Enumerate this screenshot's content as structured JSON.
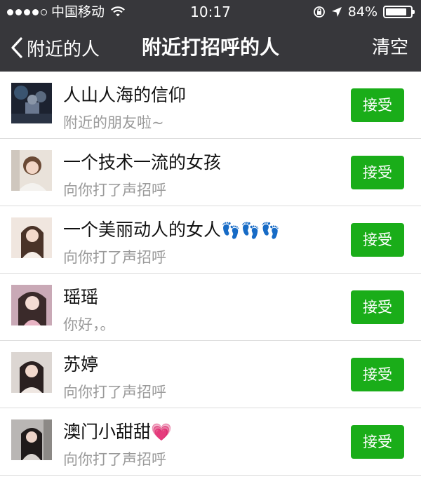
{
  "status_bar": {
    "carrier": "中国移动",
    "time": "10:17",
    "battery_text": "84%",
    "battery_level": 0.84
  },
  "nav": {
    "back_label": "附近的人",
    "title": "附近打招呼的人",
    "action_label": "清空"
  },
  "colors": {
    "header_bg": "#37373b",
    "accept_green": "#1aad19"
  },
  "rows": [
    {
      "name": "人山人海的信仰",
      "message": "附近的朋友啦~",
      "accept_label": "接受",
      "emoji": ""
    },
    {
      "name": "一个技术一流的女孩",
      "message": "向你打了声招呼",
      "accept_label": "接受",
      "emoji": ""
    },
    {
      "name": "一个美丽动人的女人",
      "message": "向你打了声招呼",
      "accept_label": "接受",
      "emoji": "👣👣👣"
    },
    {
      "name": "瑶瑶",
      "message": "你好，。",
      "accept_label": "接受",
      "emoji": ""
    },
    {
      "name": "苏婷",
      "message": "向你打了声招呼",
      "accept_label": "接受",
      "emoji": ""
    },
    {
      "name": "澳门小甜甜",
      "message": "向你打了声招呼",
      "accept_label": "接受",
      "emoji": "💗"
    }
  ]
}
